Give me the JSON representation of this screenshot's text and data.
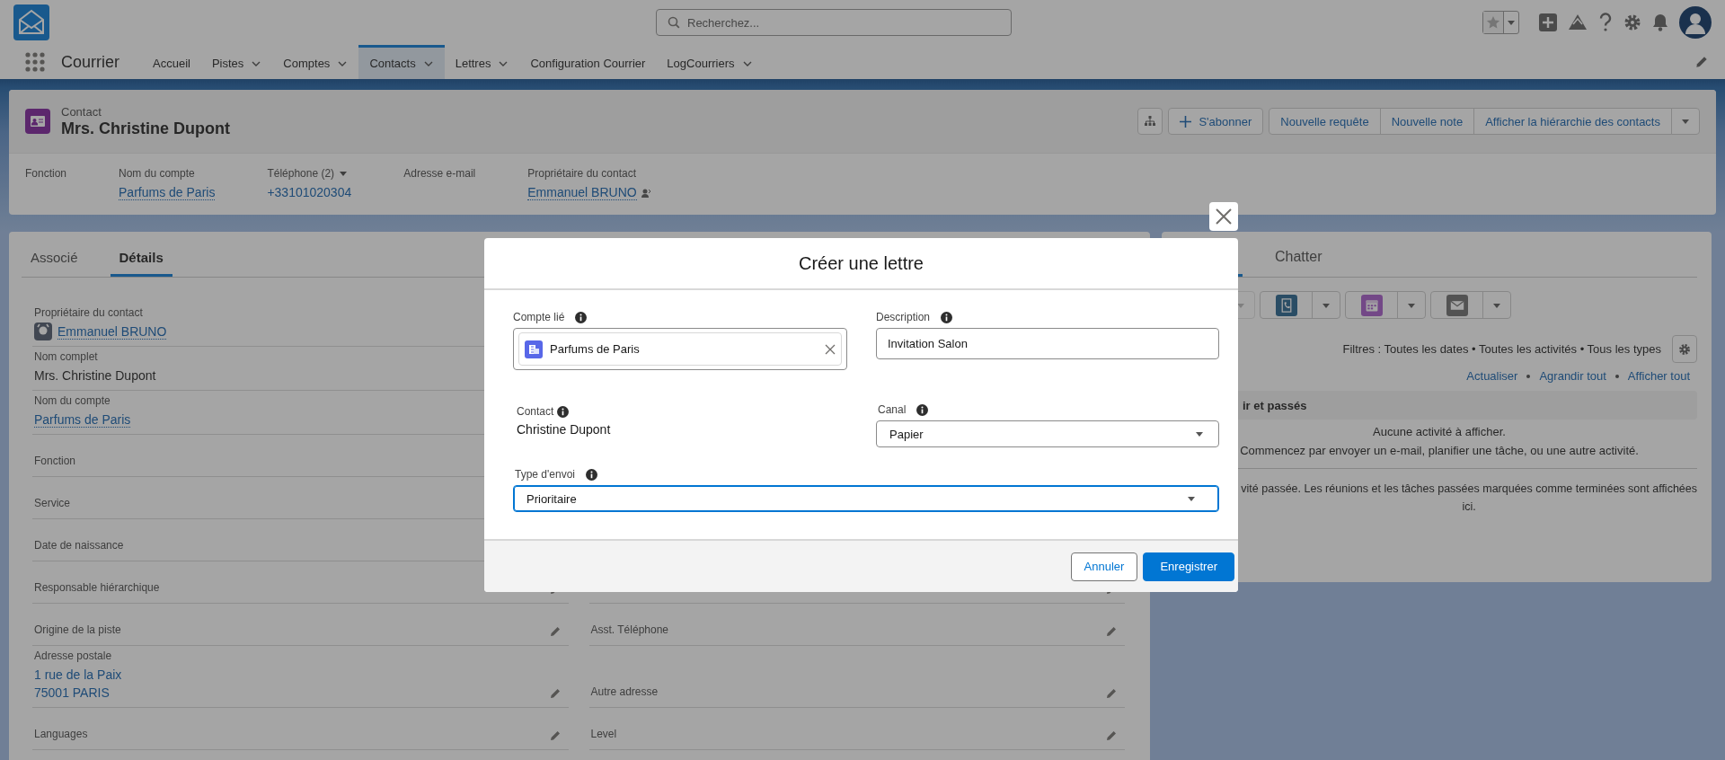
{
  "app": {
    "name": "Courrier"
  },
  "search": {
    "placeholder": "Recherchez..."
  },
  "nav": [
    {
      "label": "Accueil",
      "selected": false,
      "menu": false
    },
    {
      "label": "Pistes",
      "selected": false,
      "menu": true
    },
    {
      "label": "Comptes",
      "selected": false,
      "menu": true
    },
    {
      "label": "Contacts",
      "selected": true,
      "menu": true
    },
    {
      "label": "Lettres",
      "selected": false,
      "menu": true
    },
    {
      "label": "Configuration Courrier",
      "selected": false,
      "menu": false
    },
    {
      "label": "LogCourriers",
      "selected": false,
      "menu": true
    }
  ],
  "record": {
    "type": "Contact",
    "name": "Mrs. Christine Dupont",
    "follow": "S'abonner",
    "actions": [
      "Nouvelle requête",
      "Nouvelle note",
      "Afficher la hiérarchie des contacts"
    ]
  },
  "highlights": [
    {
      "label": "Fonction"
    },
    {
      "label": "Nom du compte",
      "value": "Parfums de Paris",
      "kind": "link"
    },
    {
      "label": "Téléphone (2)",
      "value": "+33101020304",
      "kind": "phone",
      "menu": true
    },
    {
      "label": "Adresse e-mail"
    },
    {
      "label": "Propriétaire du contact",
      "value": "Emmanuel BRUNO",
      "kind": "owner"
    }
  ],
  "details": {
    "tabs": [
      {
        "label": "Associé",
        "selected": false
      },
      {
        "label": "Détails",
        "selected": true
      }
    ],
    "left": [
      {
        "label": "Propriétaire du contact",
        "value": "Emmanuel BRUNO",
        "kind": "owner",
        "editable": false
      },
      {
        "label": "Nom complet",
        "value": "Mrs. Christine Dupont",
        "kind": "text",
        "editable": false
      },
      {
        "label": "Nom du compte",
        "value": "Parfums de Paris",
        "kind": "link",
        "editable": false
      },
      {
        "label": "Fonction",
        "editable": false
      },
      {
        "label": "Service",
        "editable": false
      },
      {
        "label": "Date de naissance",
        "editable": false
      },
      {
        "label": "Responsable hiérarchique",
        "editable": true
      },
      {
        "label": "Origine de la piste",
        "editable": true
      },
      {
        "label": "Adresse postale",
        "value": "1 rue de la Paix\n75001 PARIS",
        "kind": "address",
        "editable": true
      },
      {
        "label": "Languages",
        "editable": true
      }
    ],
    "right": [
      {
        "editable": true
      },
      {
        "label": "Asst. Téléphone",
        "editable": true
      },
      {
        "label": "Autre adresse",
        "editable": true
      },
      {
        "label": "Level",
        "editable": true
      }
    ]
  },
  "activity": {
    "tabs": [
      {
        "selected": true
      },
      {
        "label": "Chatter",
        "selected": false
      }
    ],
    "actions": [
      {
        "kind": "blank"
      },
      {
        "kind": "call"
      },
      {
        "kind": "event"
      },
      {
        "kind": "email"
      }
    ],
    "filters": "Filtres : Toutes les dates • Toutes les activités • Tous les types",
    "links": [
      "Actualiser",
      "Agrandir tout",
      "Afficher tout"
    ],
    "section": "ir et passés",
    "empty_title": "Aucune activité à afficher.",
    "empty_text": "Commencez par envoyer un e-mail, planifier une tâche, ou une autre activité.",
    "past_text": "vité passée. Les réunions et les tâches passées marquées comme terminées sont affichées\nici."
  },
  "modal": {
    "title": "Créer une lettre",
    "fields": [
      {
        "kind": "lookup",
        "label": "Compte lié",
        "value": "Parfums de Paris",
        "wide": false
      },
      {
        "kind": "text",
        "label": "Description",
        "value": "Invitation Salon",
        "wide": false
      },
      {
        "kind": "readonly",
        "label": "Contact",
        "value": "Christine Dupont",
        "wide": false
      },
      {
        "kind": "select",
        "label": "Canal",
        "value": "Papier",
        "wide": false,
        "focused": false
      },
      {
        "kind": "select",
        "label": "Type d'envoi",
        "value": "Prioritaire",
        "wide": true,
        "focused": true
      }
    ],
    "buttons": [
      {
        "label": "Annuler",
        "kind": "neutral"
      },
      {
        "label": "Enregistrer",
        "kind": "brand"
      }
    ]
  }
}
